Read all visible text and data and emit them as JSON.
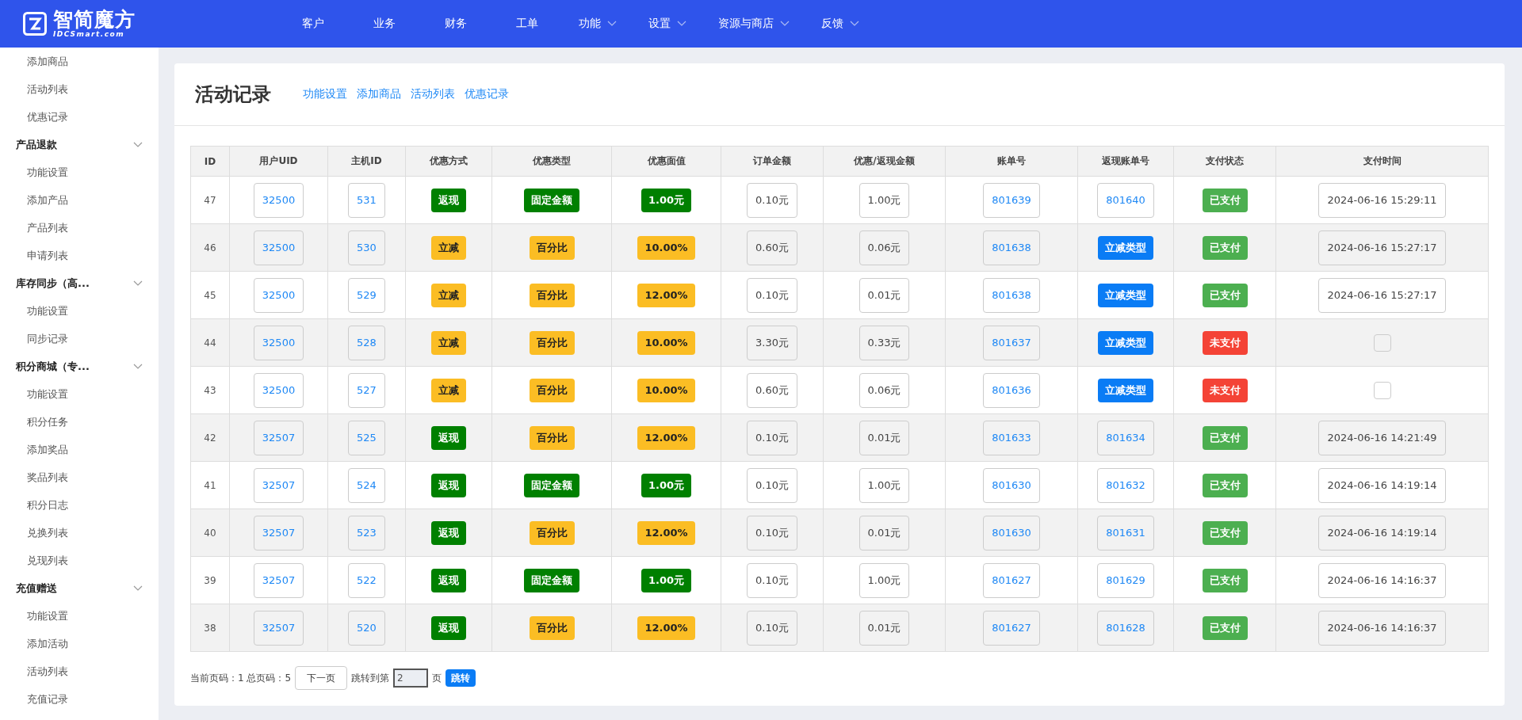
{
  "header": {
    "logo_name": "智简魔方",
    "logo_domain": "IDCSmart.com",
    "nav": [
      {
        "label": "客户",
        "has_menu": false
      },
      {
        "label": "业务",
        "has_menu": false
      },
      {
        "label": "财务",
        "has_menu": false
      },
      {
        "label": "工单",
        "has_menu": false
      },
      {
        "label": "功能",
        "has_menu": true
      },
      {
        "label": "设置",
        "has_menu": true
      },
      {
        "label": "资源与商店",
        "has_menu": true
      },
      {
        "label": "反馈",
        "has_menu": true
      }
    ]
  },
  "sidebar": {
    "leading_items": [
      "添加商品",
      "活动列表",
      "优惠记录"
    ],
    "groups": [
      {
        "title": "产品退款",
        "expanded": true,
        "children": [
          "功能设置",
          "添加产品",
          "产品列表",
          "申请列表"
        ]
      },
      {
        "title": "库存同步（高...",
        "expanded": true,
        "children": [
          "功能设置",
          "同步记录"
        ]
      },
      {
        "title": "积分商城（专...",
        "expanded": true,
        "children": [
          "功能设置",
          "积分任务",
          "添加奖品",
          "奖品列表",
          "积分日志",
          "兑换列表",
          "兑现列表"
        ]
      },
      {
        "title": "充值赠送",
        "expanded": true,
        "children": [
          "功能设置",
          "添加活动",
          "活动列表",
          "充值记录"
        ]
      }
    ]
  },
  "page": {
    "title": "活动记录",
    "links": [
      "功能设置",
      "添加商品",
      "活动列表",
      "优惠记录"
    ]
  },
  "table": {
    "columns": [
      "ID",
      "用户UID",
      "主机ID",
      "优惠方式",
      "优惠类型",
      "优惠面值",
      "订单金额",
      "优惠/返现金额",
      "账单号",
      "返现账单号",
      "支付状态",
      "支付时间"
    ],
    "rows": [
      {
        "id": "47",
        "uid": "32500",
        "host_id": "531",
        "method": {
          "kind": "cashback",
          "label": "返现"
        },
        "type": {
          "kind": "fixed",
          "label": "固定金额"
        },
        "face_value": "1.00元",
        "order_amount": "0.10元",
        "discount_amount": "1.00元",
        "bill_no": "801639",
        "cashback_bill": {
          "kind": "number",
          "label": "801640"
        },
        "status": {
          "paid": true,
          "label": "已支付"
        },
        "pay_time": "2024-06-16 15:29:11"
      },
      {
        "id": "46",
        "uid": "32500",
        "host_id": "530",
        "method": {
          "kind": "instant",
          "label": "立减"
        },
        "type": {
          "kind": "percent",
          "label": "百分比"
        },
        "face_value": "10.00%",
        "order_amount": "0.60元",
        "discount_amount": "0.06元",
        "bill_no": "801638",
        "cashback_bill": {
          "kind": "tag",
          "label": "立减类型"
        },
        "status": {
          "paid": true,
          "label": "已支付"
        },
        "pay_time": "2024-06-16 15:27:17"
      },
      {
        "id": "45",
        "uid": "32500",
        "host_id": "529",
        "method": {
          "kind": "instant",
          "label": "立减"
        },
        "type": {
          "kind": "percent",
          "label": "百分比"
        },
        "face_value": "12.00%",
        "order_amount": "0.10元",
        "discount_amount": "0.01元",
        "bill_no": "801638",
        "cashback_bill": {
          "kind": "tag",
          "label": "立减类型"
        },
        "status": {
          "paid": true,
          "label": "已支付"
        },
        "pay_time": "2024-06-16 15:27:17"
      },
      {
        "id": "44",
        "uid": "32500",
        "host_id": "528",
        "method": {
          "kind": "instant",
          "label": "立减"
        },
        "type": {
          "kind": "percent",
          "label": "百分比"
        },
        "face_value": "10.00%",
        "order_amount": "3.30元",
        "discount_amount": "0.33元",
        "bill_no": "801637",
        "cashback_bill": {
          "kind": "tag",
          "label": "立减类型"
        },
        "status": {
          "paid": false,
          "label": "未支付"
        }
      },
      {
        "id": "43",
        "uid": "32500",
        "host_id": "527",
        "method": {
          "kind": "instant",
          "label": "立减"
        },
        "type": {
          "kind": "percent",
          "label": "百分比"
        },
        "face_value": "10.00%",
        "order_amount": "0.60元",
        "discount_amount": "0.06元",
        "bill_no": "801636",
        "cashback_bill": {
          "kind": "tag",
          "label": "立减类型"
        },
        "status": {
          "paid": false,
          "label": "未支付"
        }
      },
      {
        "id": "42",
        "uid": "32507",
        "host_id": "525",
        "method": {
          "kind": "cashback",
          "label": "返现"
        },
        "type": {
          "kind": "percent",
          "label": "百分比"
        },
        "face_value": "12.00%",
        "order_amount": "0.10元",
        "discount_amount": "0.01元",
        "bill_no": "801633",
        "cashback_bill": {
          "kind": "number",
          "label": "801634"
        },
        "status": {
          "paid": true,
          "label": "已支付"
        },
        "pay_time": "2024-06-16 14:21:49"
      },
      {
        "id": "41",
        "uid": "32507",
        "host_id": "524",
        "method": {
          "kind": "cashback",
          "label": "返现"
        },
        "type": {
          "kind": "fixed",
          "label": "固定金额"
        },
        "face_value": "1.00元",
        "order_amount": "0.10元",
        "discount_amount": "1.00元",
        "bill_no": "801630",
        "cashback_bill": {
          "kind": "number",
          "label": "801632"
        },
        "status": {
          "paid": true,
          "label": "已支付"
        },
        "pay_time": "2024-06-16 14:19:14"
      },
      {
        "id": "40",
        "uid": "32507",
        "host_id": "523",
        "method": {
          "kind": "cashback",
          "label": "返现"
        },
        "type": {
          "kind": "percent",
          "label": "百分比"
        },
        "face_value": "12.00%",
        "order_amount": "0.10元",
        "discount_amount": "0.01元",
        "bill_no": "801630",
        "cashback_bill": {
          "kind": "number",
          "label": "801631"
        },
        "status": {
          "paid": true,
          "label": "已支付"
        },
        "pay_time": "2024-06-16 14:19:14"
      },
      {
        "id": "39",
        "uid": "32507",
        "host_id": "522",
        "method": {
          "kind": "cashback",
          "label": "返现"
        },
        "type": {
          "kind": "fixed",
          "label": "固定金额"
        },
        "face_value": "1.00元",
        "order_amount": "0.10元",
        "discount_amount": "1.00元",
        "bill_no": "801627",
        "cashback_bill": {
          "kind": "number",
          "label": "801629"
        },
        "status": {
          "paid": true,
          "label": "已支付"
        },
        "pay_time": "2024-06-16 14:16:37"
      },
      {
        "id": "38",
        "uid": "32507",
        "host_id": "520",
        "method": {
          "kind": "cashback",
          "label": "返现"
        },
        "type": {
          "kind": "percent",
          "label": "百分比"
        },
        "face_value": "12.00%",
        "order_amount": "0.10元",
        "discount_amount": "0.01元",
        "bill_no": "801627",
        "cashback_bill": {
          "kind": "number",
          "label": "801628"
        },
        "status": {
          "paid": true,
          "label": "已支付"
        },
        "pay_time": "2024-06-16 14:16:37"
      }
    ]
  },
  "pagination": {
    "info": "当前页码：1 总页码：5",
    "next_button": "下一页",
    "jump_prefix": "跳转到第",
    "page_input": "2",
    "jump_suffix": "页",
    "jump_button": "跳转"
  }
}
